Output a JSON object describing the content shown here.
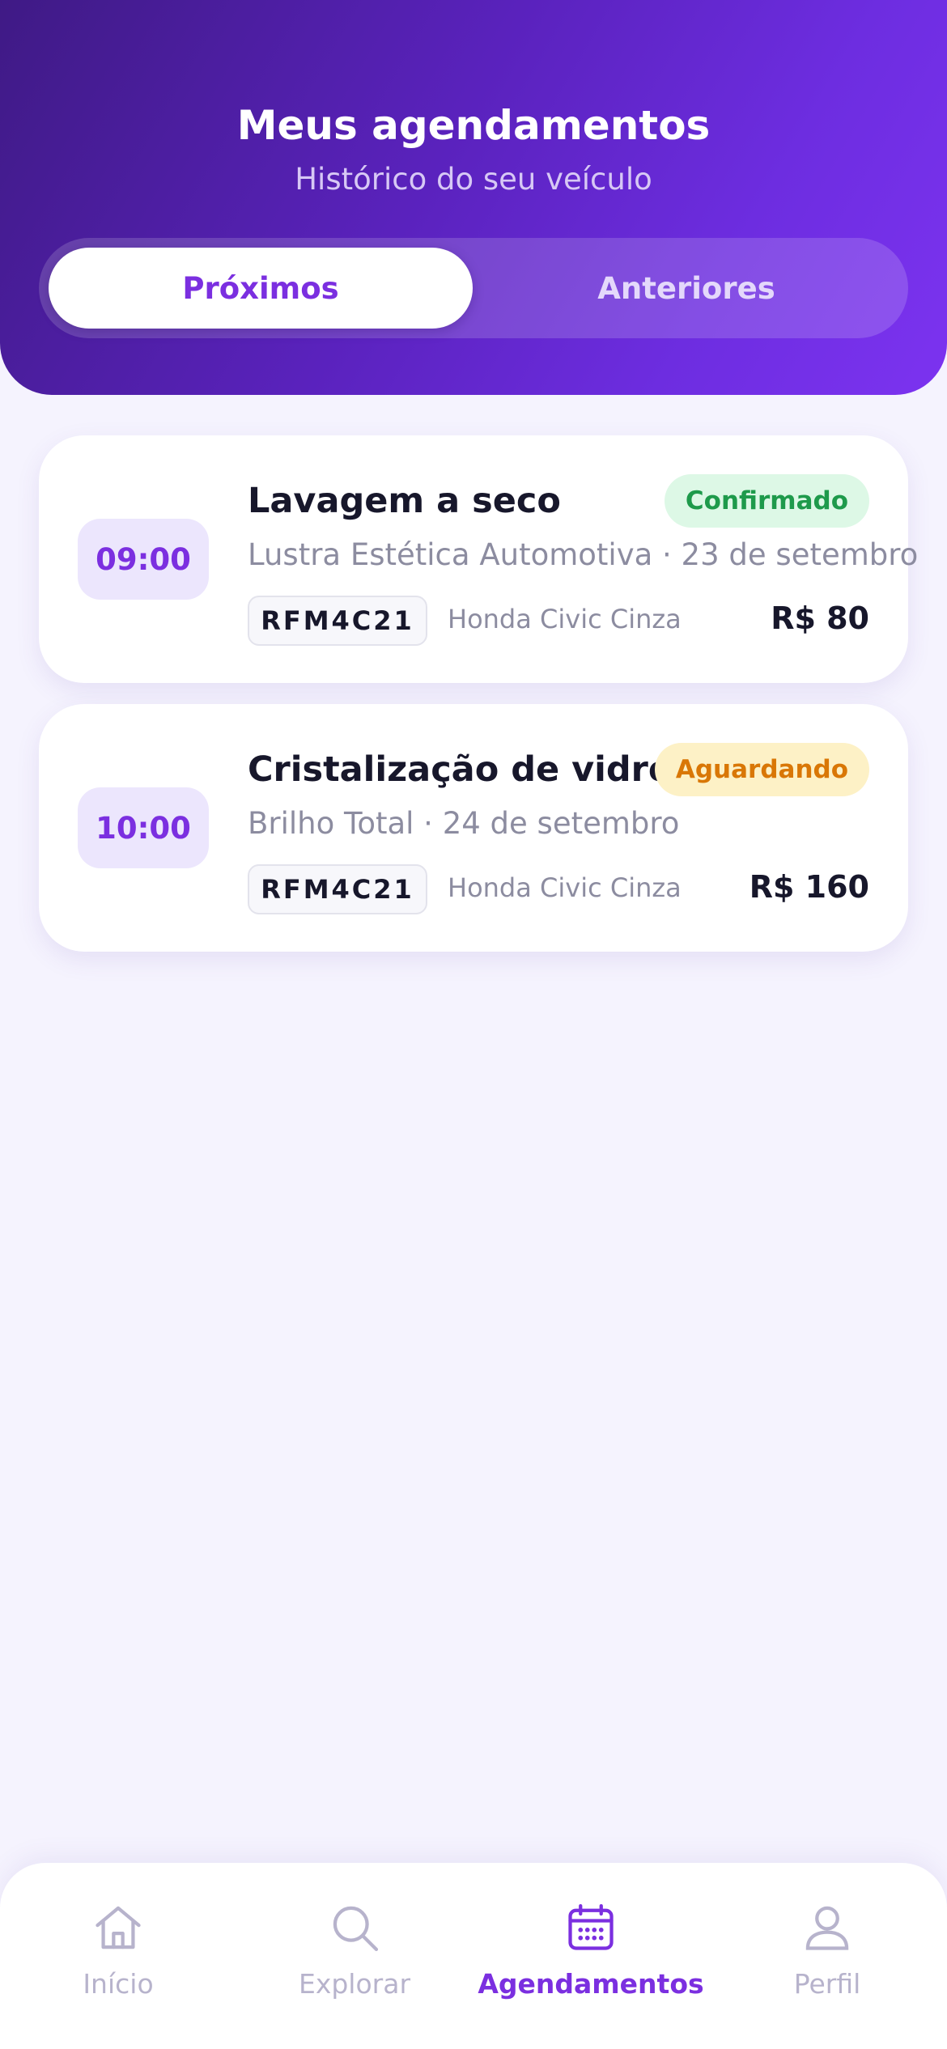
{
  "header": {
    "title": "Meus agendamentos",
    "subtitle": "Histórico do seu veículo",
    "tabs": [
      {
        "label": "Próximos",
        "active": true
      },
      {
        "label": "Anteriores",
        "active": false
      }
    ]
  },
  "appointments": [
    {
      "time": "09:00",
      "service": "Lavagem a seco",
      "status": "Confirmado",
      "details": "Lustra Estética Automotiva · 23 de setembro",
      "plate": "RFM4C21",
      "car": "Honda Civic Cinza",
      "price": "R$ 80"
    },
    {
      "time": "10:00",
      "service": "Cristalização de vidros",
      "status": "Aguardando",
      "details": "Brilho Total · 24 de setembro",
      "plate": "RFM4C21",
      "car": "Honda Civic Cinza",
      "price": "R$ 160"
    }
  ],
  "nav": [
    {
      "label": "Início",
      "icon": "home-icon",
      "active": false
    },
    {
      "label": "Explorar",
      "icon": "search-icon",
      "active": false
    },
    {
      "label": "Agendamentos",
      "icon": "calendar-icon",
      "active": true
    },
    {
      "label": "Perfil",
      "icon": "user-icon",
      "active": false
    }
  ],
  "colors": {
    "accent": "#7b2fe0",
    "header_gradient_start": "#3f1a85",
    "header_gradient_end": "#7c33f0",
    "status_confirmed": "#1e9a4b",
    "status_waiting": "#d97706",
    "background": "#f5f3fe"
  }
}
